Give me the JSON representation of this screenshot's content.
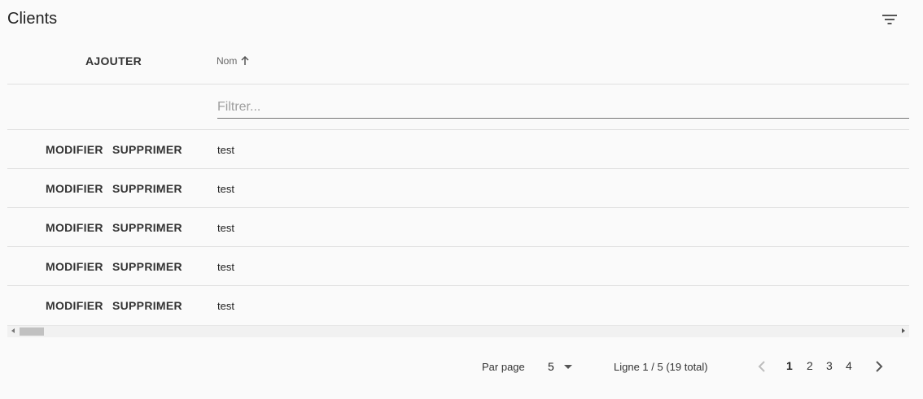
{
  "header": {
    "title": "Clients",
    "add_label": "AJOUTER",
    "column_name": "Nom",
    "filter_placeholder": "Filtrer...",
    "filter_value": ""
  },
  "row_actions": {
    "modify_label": "MODIFIER",
    "delete_label": "SUPPRIMER"
  },
  "rows": [
    {
      "name": "test"
    },
    {
      "name": "test"
    },
    {
      "name": "test"
    },
    {
      "name": "test"
    },
    {
      "name": "test"
    }
  ],
  "pagination": {
    "per_page_label": "Par page",
    "per_page_value": "5",
    "range_label": "Ligne 1 / 5 (19 total)",
    "pages": [
      "1",
      "2",
      "3",
      "4"
    ],
    "active_page": "1"
  },
  "icons": {
    "filter": "filter-list-icon",
    "sort": "arrow-upward-icon",
    "prev": "chevron-left-icon",
    "next": "chevron-right-icon"
  }
}
